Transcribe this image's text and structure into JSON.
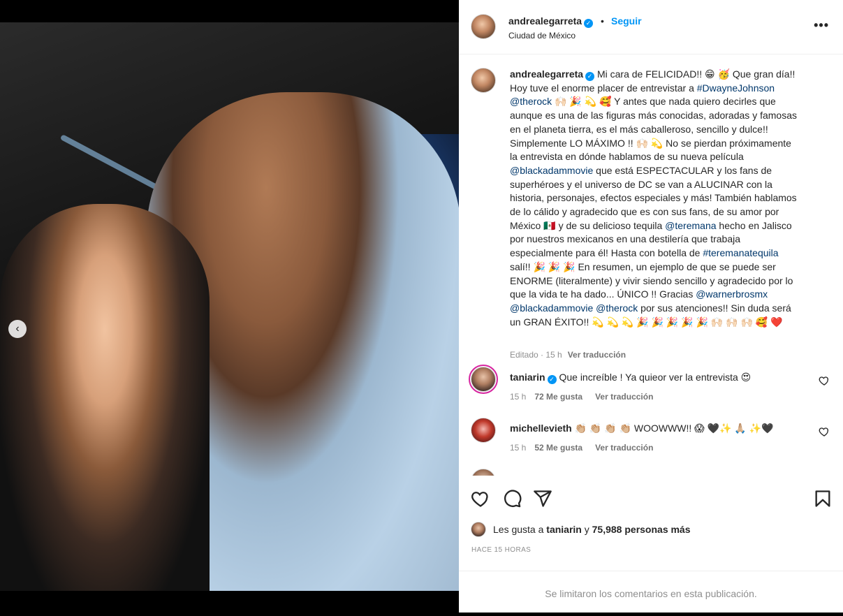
{
  "header": {
    "username": "andrealegarreta",
    "separator": "•",
    "follow": "Seguir",
    "location": "Ciudad de México",
    "more": "•••"
  },
  "media": {
    "nav_prev": "‹",
    "dots": 4,
    "active_dot": 4
  },
  "caption": {
    "username": "andrealegarreta",
    "lines": [
      "Mi cara de FELICIDAD!! 😁 🥳 Que gran día!!",
      "Hoy tuve el enorme placer de entrevistar a #DwayneJohnson",
      "@therock 🙌🏻 🎉 💫 🥰 Y antes que nada quiero decirles que",
      "aunque es una de las figuras más conocidas, adoradas y famosas",
      "en el planeta tierra, es el más caballeroso, sencillo y dulce!!",
      "Simplemente LO MÁXIMO !! 🙌🏻 💫 No se pierdan próximamente",
      "la entrevista en dónde hablamos de su nueva película",
      "@blackadammovie que está ESPECTACULAR y los fans de",
      "superhéroes y el universo de DC se van a ALUCINAR con la",
      "historia, personajes, efectos especiales y más! También hablamos",
      "de lo cálido y agradecido que es con sus fans, de su amor por",
      "México 🇲🇽 y de su delicioso tequila @teremana hecho en Jalisco",
      "por nuestros mexicanos en una destilería que trabaja",
      "especialmente para él! Hasta con botella de #teremanatequila",
      "salí!! 🎉 🎉 🎉 En resumen, un ejemplo de que se puede ser",
      "ENORME (literalmente) y vivir siendo sencillo y agradecido por lo",
      "que la vida te ha dado... ÚNICO !! Gracias @warnerbrosmx",
      "@blackadammovie @therock por sus atenciones!! Sin duda será",
      "un GRAN ÉXITO!! 💫 💫 💫 🎉 🎉 🎉 🎉 🎉 🙌🏻 🙌🏻 🙌🏻 🥰 ❤️"
    ],
    "edited": "Editado · 15 h",
    "translate": "Ver traducción"
  },
  "comments": [
    {
      "username": "taniarin",
      "text": "Que increíble ! Ya quieor ver la entrevista 😍",
      "time": "15 h",
      "likes": "72 Me gusta",
      "translate": "Ver traducción"
    },
    {
      "username": "michellevieth",
      "text": "👏🏼 👏🏼 👏🏼 👏🏼 WOOWWW!! 😱 🖤✨ 🙏🏼 ✨🖤",
      "time": "15 h",
      "likes": "52 Me gusta",
      "translate": "Ver traducción"
    }
  ],
  "likes_summary": {
    "prefix": "Les gusta a",
    "user": "taniarin",
    "joiner": "y",
    "others": "75,988 personas más"
  },
  "timestamp": "HACE 15 HORAS",
  "comments_limited": "Se limitaron los comentarios en esta publicación.",
  "colors": {
    "accent": "#0095f6",
    "link": "#00376b",
    "muted": "#8e8e8e",
    "like_red": "#ed4956"
  }
}
